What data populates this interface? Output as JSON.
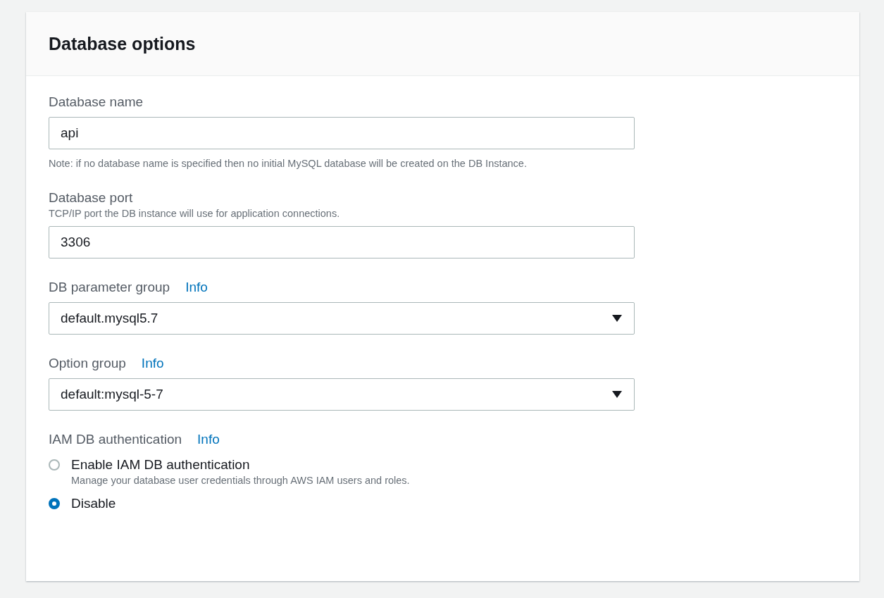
{
  "panel": {
    "title": "Database options"
  },
  "fields": [
    {
      "kind": "text",
      "label": "Database name",
      "value": "api",
      "note": "Note: if no database name is specified then no initial MySQL database will be created on the DB Instance."
    },
    {
      "kind": "text",
      "label": "Database port",
      "description": "TCP/IP port the DB instance will use for application connections.",
      "value": "3306"
    },
    {
      "kind": "select",
      "label": "DB parameter group",
      "info": "Info",
      "value": "default.mysql5.7"
    },
    {
      "kind": "select",
      "label": "Option group",
      "info": "Info",
      "value": "default:mysql-5-7"
    },
    {
      "kind": "radio",
      "label": "IAM DB authentication",
      "info": "Info",
      "options": [
        {
          "label": "Enable IAM DB authentication",
          "description": "Manage your database user credentials through AWS IAM users and roles.",
          "selected": false
        },
        {
          "label": "Disable",
          "selected": true
        }
      ]
    }
  ]
}
